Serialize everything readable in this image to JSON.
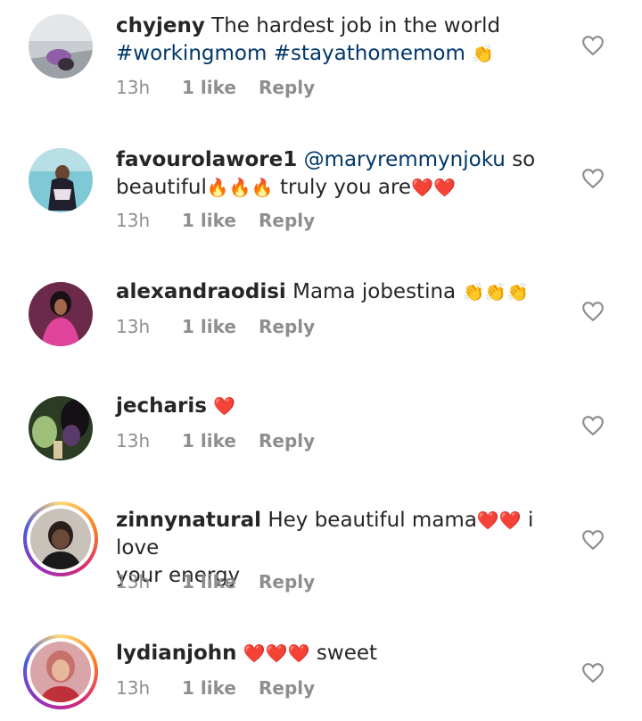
{
  "comments": [
    {
      "username": "chyjeny",
      "text": "The hardest job in the world",
      "hashtags": "#workingmom #stayathomemom",
      "emoji": "👏",
      "time": "13h",
      "likes": "1 like",
      "reply": "Reply"
    },
    {
      "username": "favourolawore1",
      "mention": "@maryremmynjoku",
      "text_1": "so",
      "text_2": "beautiful",
      "emoji_1": "🔥🔥🔥",
      "text_3": "truly you are",
      "emoji_2": "❤️❤️",
      "time": "13h",
      "likes": "1 like",
      "reply": "Reply"
    },
    {
      "username": "alexandraodisi",
      "text": "Mama jobestina",
      "emoji": "👏👏👏",
      "time": "13h",
      "likes": "1 like",
      "reply": "Reply"
    },
    {
      "username": "jecharis",
      "emoji": "❤️",
      "time": "13h",
      "likes": "1 like",
      "reply": "Reply"
    },
    {
      "username": "zinnynatural",
      "text_1": "Hey beautiful mama",
      "emoji": "❤️❤️",
      "text_2": "i love",
      "text_3": "your energy",
      "time": "13h",
      "likes": "1 like",
      "reply": "Reply"
    },
    {
      "username": "lydianjohn",
      "emoji": "❤️❤️❤️",
      "text": "sweet",
      "time": "13h",
      "likes": "1 like",
      "reply": "Reply"
    }
  ],
  "icons": {
    "like": "heart-outline-icon"
  },
  "colors": {
    "link": "#00376b",
    "meta": "#8e8e8e",
    "text": "#262626"
  }
}
